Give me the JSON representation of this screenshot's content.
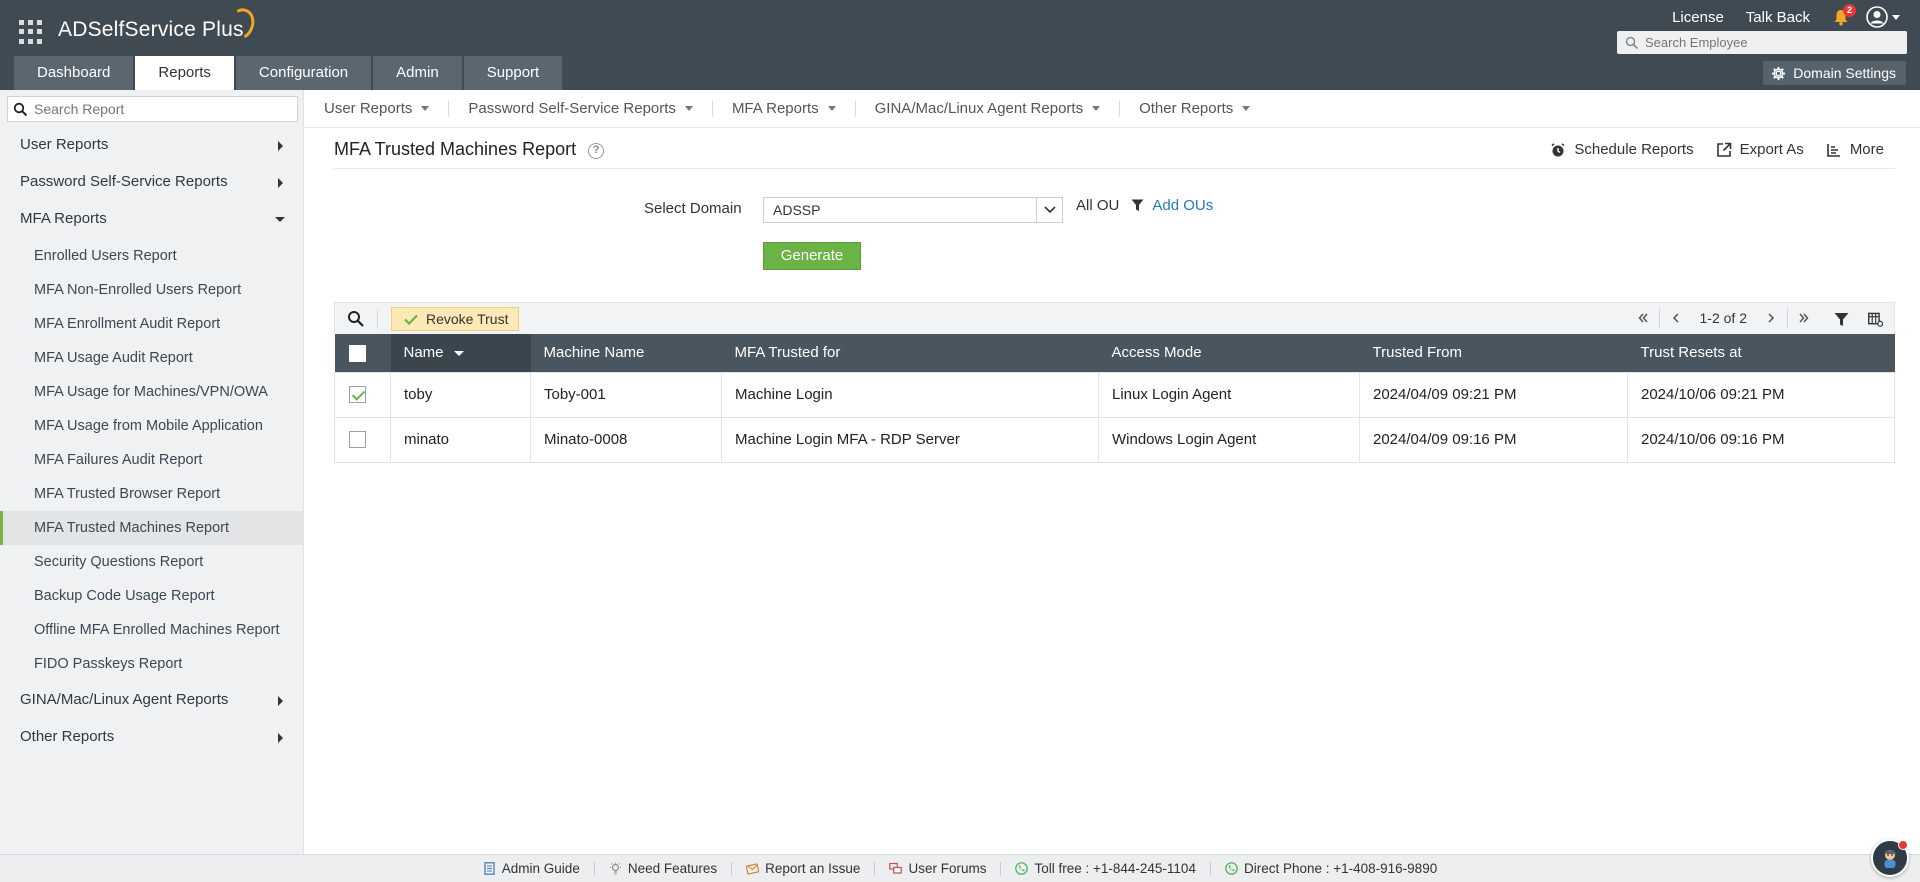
{
  "header": {
    "logo_text": "ADSelfService Plus",
    "links": [
      "License",
      "Talk Back"
    ],
    "notification_count": "2",
    "employee_search_placeholder": "Search Employee",
    "domain_settings_label": "Domain Settings"
  },
  "nav_tabs": [
    {
      "label": "Dashboard",
      "active": false
    },
    {
      "label": "Reports",
      "active": true
    },
    {
      "label": "Configuration",
      "active": false
    },
    {
      "label": "Admin",
      "active": false
    },
    {
      "label": "Support",
      "active": false
    }
  ],
  "sidebar": {
    "search_placeholder": "Search Report",
    "categories": [
      {
        "label": "User Reports",
        "expanded": false
      },
      {
        "label": "Password Self-Service Reports",
        "expanded": false
      },
      {
        "label": "MFA Reports",
        "expanded": true
      },
      {
        "label": "GINA/Mac/Linux Agent Reports",
        "expanded": false
      },
      {
        "label": "Other Reports",
        "expanded": false
      }
    ],
    "mfa_items": [
      "Enrolled Users Report",
      "MFA Non-Enrolled Users Report",
      "MFA Enrollment Audit Report",
      "MFA Usage Audit Report",
      "MFA Usage for Machines/VPN/OWA",
      "MFA Usage from Mobile Application",
      "MFA Failures Audit Report",
      "MFA Trusted Browser Report",
      "MFA Trusted Machines Report",
      "Security Questions Report",
      "Backup Code Usage Report",
      "Offline MFA Enrolled Machines Report",
      "FIDO Passkeys Report"
    ],
    "active_item": "MFA Trusted Machines Report"
  },
  "subnav": [
    "User Reports",
    "Password Self-Service Reports",
    "MFA Reports",
    "GINA/Mac/Linux Agent Reports",
    "Other Reports"
  ],
  "main": {
    "title": "MFA Trusted Machines Report",
    "help": "?",
    "actions": {
      "schedule": "Schedule Reports",
      "export": "Export As",
      "more": "More"
    },
    "domain_label": "Select Domain",
    "domain_value": "ADSSP",
    "ou_label": "All OU",
    "add_ous": "Add OUs",
    "generate": "Generate"
  },
  "toolbar": {
    "revoke_label": "Revoke Trust",
    "page_text": "1-2 of 2"
  },
  "table": {
    "columns": [
      "Name",
      "Machine Name",
      "MFA Trusted for",
      "Access Mode",
      "Trusted From",
      "Trust Resets at"
    ],
    "rows": [
      {
        "checked": true,
        "cells": [
          "toby",
          "Toby-001",
          "Machine Login",
          "Linux Login Agent",
          "2024/04/09 09:21 PM",
          "2024/10/06 09:21 PM"
        ]
      },
      {
        "checked": false,
        "cells": [
          "minato",
          "Minato-0008",
          "Machine Login MFA - RDP Server",
          "Windows Login Agent",
          "2024/04/09 09:16 PM",
          "2024/10/06 09:16 PM"
        ]
      }
    ]
  },
  "footer": [
    {
      "label": "Admin Guide",
      "icon": "book-icon"
    },
    {
      "label": "Need Features",
      "icon": "bulb-icon"
    },
    {
      "label": "Report an Issue",
      "icon": "envelope-icon"
    },
    {
      "label": "User Forums",
      "icon": "forum-icon"
    },
    {
      "label": "Toll free : +1-844-245-1104",
      "icon": "phone-icon"
    },
    {
      "label": "Direct Phone : +1-408-916-9890",
      "icon": "phone-icon"
    }
  ],
  "colors": {
    "accent_green": "#6ab344",
    "header_bg": "#3f4a53",
    "link_blue": "#1f7ab8"
  }
}
